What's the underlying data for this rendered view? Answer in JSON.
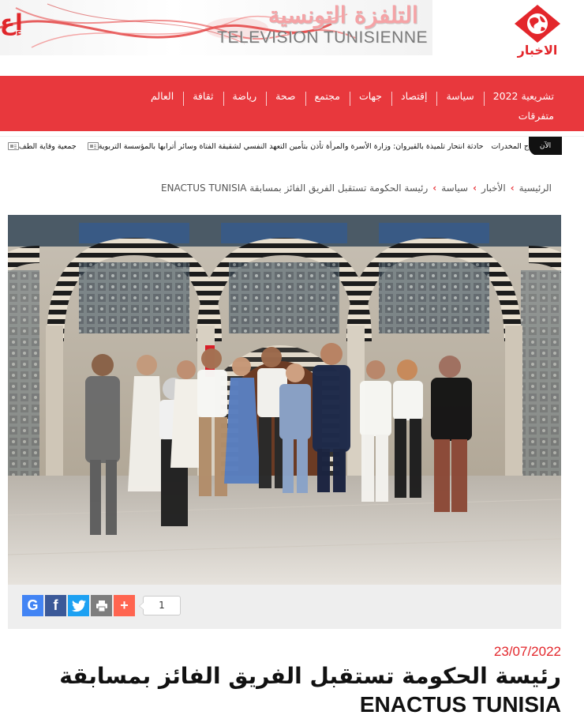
{
  "header": {
    "banner_title_ar": "التلفزة التونسية",
    "banner_title_fr": "TELEVISION TUNISIENNE",
    "banner_edge_fragment": "إع",
    "logo_text": "الاخبار"
  },
  "nav": {
    "items": [
      "تشريعية 2022",
      "سياسة",
      "إقتصاد",
      "جهات",
      "مجتمع",
      "صحة",
      "رياضة",
      "ثقافة",
      "العالم"
    ],
    "row2_item": "متفرقات"
  },
  "ticker": {
    "badge": "الآن",
    "items": [
      "ج المخدرات",
      "حادثة انتحار تلميذة بالقيروان: وزارة الأسرة والمرأة تأذن بتأمين التعهد النفسي لشقيقة الفتاة وسائر أترابها بالمؤسسة التربوية",
      "جمعية وقاية الطف"
    ]
  },
  "breadcrumb": {
    "items": [
      "الرئيسية",
      "الأخبار",
      "سياسة"
    ],
    "current": "رئيسة الحكومة تستقبل الفريق الفائز بمسابقة ENACTUS TUNISIA"
  },
  "share": {
    "buttons": [
      "google-plus",
      "facebook",
      "twitter",
      "print",
      "add-more"
    ],
    "count": "1"
  },
  "article": {
    "date": "23/07/2022",
    "title_line1": "رئيسة الحكومة تستقبل الفريق الفائز بمسابقة",
    "title_line2": "ENACTUS TUNISIA"
  },
  "colors": {
    "brand_red": "#e8383d",
    "date_red": "#e3262b"
  }
}
